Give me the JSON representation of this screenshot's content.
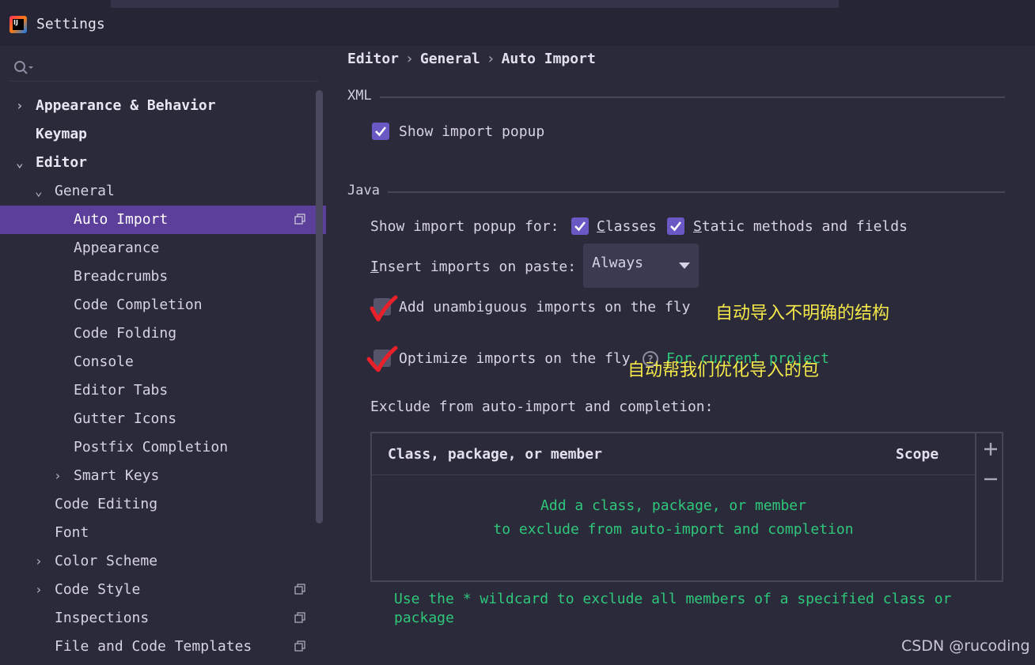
{
  "window": {
    "title": "Settings"
  },
  "sidebar": {
    "search_placeholder": "",
    "items": [
      {
        "label": "Appearance & Behavior",
        "chevron": "›"
      },
      {
        "label": "Keymap"
      },
      {
        "label": "Editor",
        "chevron": "⌄"
      },
      {
        "label": "General",
        "chevron": "⌄"
      },
      {
        "label": "Auto Import"
      },
      {
        "label": "Appearance"
      },
      {
        "label": "Breadcrumbs"
      },
      {
        "label": "Code Completion"
      },
      {
        "label": "Code Folding"
      },
      {
        "label": "Console"
      },
      {
        "label": "Editor Tabs"
      },
      {
        "label": "Gutter Icons"
      },
      {
        "label": "Postfix Completion"
      },
      {
        "label": "Smart Keys",
        "chevron": "›"
      },
      {
        "label": "Code Editing"
      },
      {
        "label": "Font"
      },
      {
        "label": "Color Scheme",
        "chevron": "›"
      },
      {
        "label": "Code Style",
        "chevron": "›"
      },
      {
        "label": "Inspections"
      },
      {
        "label": "File and Code Templates"
      }
    ]
  },
  "breadcrumb": {
    "level1": "Editor",
    "level2": "General",
    "level3": "Auto Import",
    "separator": "›"
  },
  "xml_section": {
    "title": "XML",
    "show_import_popup": {
      "label": "Show import popup",
      "checked": true
    }
  },
  "java_section": {
    "title": "Java",
    "show_popup_for": {
      "label": "Show import popup for:",
      "classes": {
        "first": "C",
        "rest": "lasses",
        "checked": true
      },
      "static": {
        "first": "S",
        "rest": "tatic methods and fields",
        "checked": true
      }
    },
    "insert_on_paste": {
      "first": "I",
      "rest": "nsert imports on paste:",
      "value": "Always"
    },
    "add_unambiguous": {
      "label": "Add unambiguous imports on the fly",
      "checked": true
    },
    "optimize": {
      "label": "Optimize imports on the fly",
      "scope": "For current project",
      "checked": true
    },
    "exclude_label": "Exclude from auto-import and completion:"
  },
  "exclude_table": {
    "columns": [
      "Class, package, or member",
      "Scope"
    ],
    "empty_line1": "Add a class, package, or member",
    "empty_line2": "to exclude from auto-import and completion",
    "add_button": "+",
    "remove_button": "−"
  },
  "hint": {
    "line1": "Use the * wildcard to exclude all members of a specified class or",
    "line2": "package"
  },
  "annotations": {
    "note1": "自动导入不明确的结构",
    "note2": "自动帮我们优化导入的包"
  },
  "watermark": "CSDN @rucoding",
  "colors": {
    "background": "#2b2a3a",
    "selection": "#5c3f9a",
    "checkbox": "#6a58c4",
    "green_text": "#2fc77a",
    "annotation_yellow": "#f5e94a",
    "red_mark": "#e8202a"
  }
}
